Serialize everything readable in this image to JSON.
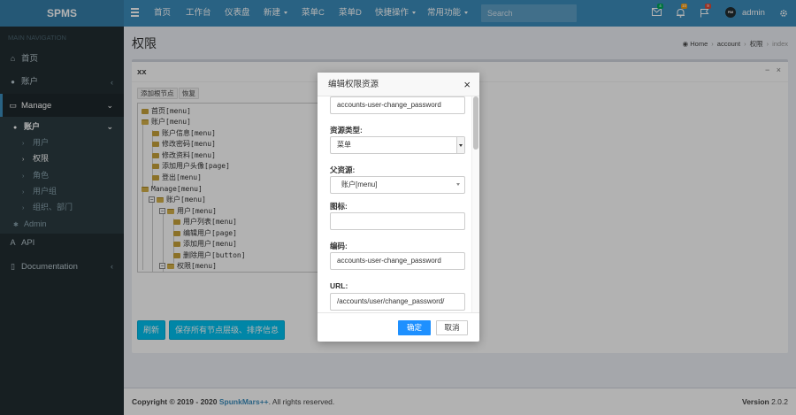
{
  "header": {
    "logo": "SPMS",
    "nav": [
      {
        "label": "首页",
        "dropdown": false
      },
      {
        "label": "工作台",
        "dropdown": false
      },
      {
        "label": "仪表盘",
        "dropdown": false
      },
      {
        "label": "新建",
        "dropdown": true
      },
      {
        "label": "菜单C",
        "dropdown": false
      },
      {
        "label": "菜单D",
        "dropdown": false
      },
      {
        "label": "快捷操作",
        "dropdown": true
      },
      {
        "label": "常用功能",
        "dropdown": true
      }
    ],
    "search_placeholder": "Search",
    "badges": {
      "mail": "4",
      "bell": "10",
      "flag": "9"
    },
    "badge_colors": {
      "mail": "#00a65a",
      "bell": "#f39c12",
      "flag": "#dd4b39"
    },
    "avatar_text": "PIM",
    "username": "admin",
    "icons": [
      "menu-icon",
      "envelope-icon",
      "bell-icon",
      "flag-icon",
      "gears-icon"
    ]
  },
  "sidebar": {
    "heading": "MAIN NAVIGATION",
    "items": [
      {
        "icon": "home-icon",
        "glyph": "⌂",
        "label": "首页"
      },
      {
        "icon": "user-icon",
        "glyph": "👤",
        "label": "账户"
      },
      {
        "icon": "dashboard-icon",
        "glyph": "▭",
        "label": "Manage"
      },
      {
        "icon": "api-icon",
        "glyph": "A",
        "label": "API"
      },
      {
        "icon": "book-icon",
        "glyph": "▯",
        "label": "Documentation"
      }
    ],
    "sub_group": "账户",
    "sub_items": [
      "用户",
      "权限",
      "角色",
      "用户组",
      "组织、部门"
    ],
    "admin": "Admin"
  },
  "page": {
    "title": "权限",
    "breadcrumb": [
      "Home",
      "account",
      "权限",
      "index"
    ]
  },
  "box": {
    "title": "xx",
    "tools": [
      "−",
      "×"
    ],
    "add_root_label": "添加根节点",
    "restore_label": "恢复",
    "tree": [
      "首页[menu]",
      "账户[menu]",
      "账户信息[menu]",
      "修改密码[menu]",
      "修改资料[menu]",
      "添加用户头像[page]",
      "登出[menu]",
      "Manage[menu]",
      "账户[menu]",
      "用户[menu]",
      "用户列表[menu]",
      "编辑用户[page]",
      "添加用户[menu]",
      "删除用户[button]",
      "权限[menu]"
    ],
    "refresh_label": "刷新",
    "save_label": "保存所有节点层级、排序信息"
  },
  "modal": {
    "title": "编辑权限资源",
    "top_field_value": "accounts-user-change_password",
    "type_label": "资源类型:",
    "type_value": "菜单",
    "parent_label": "父资源:",
    "parent_value": "账户[menu]",
    "icon_label": "图标:",
    "icon_value": "",
    "code_label": "编码:",
    "code_value": "accounts-user-change_password",
    "url_label": "URL:",
    "url_value": "/accounts/user/change_password/",
    "ok_label": "确定",
    "cancel_label": "取消"
  },
  "footer": {
    "copyright_prefix": "Copyright © 2019 - 2020",
    "brand": "SpunkMars++",
    "rights": ". All rights reserved.",
    "version_label": "Version",
    "version": "2.0.2"
  }
}
